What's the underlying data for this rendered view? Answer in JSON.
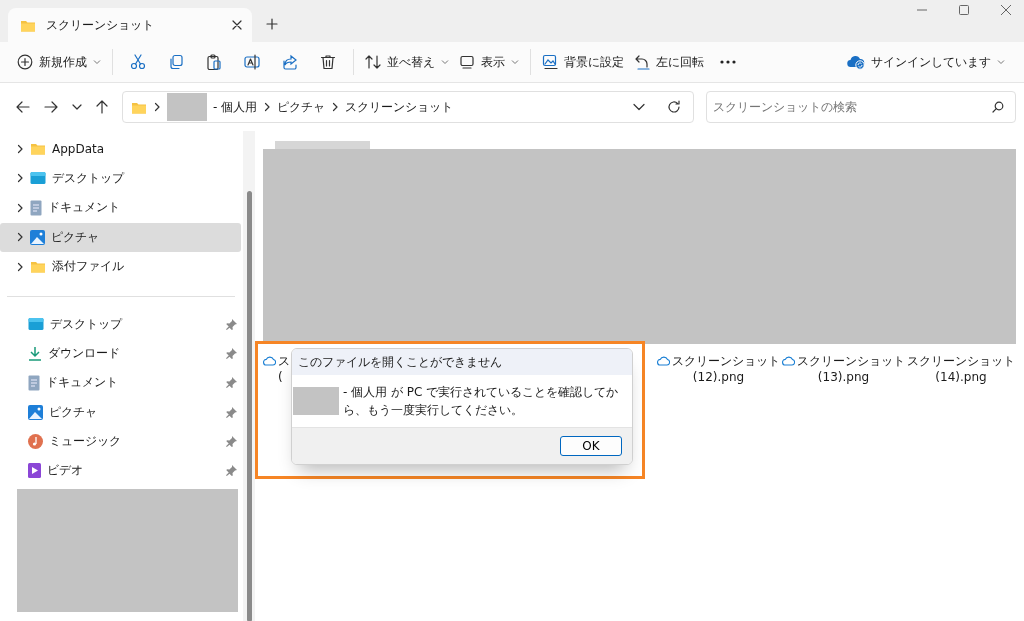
{
  "window": {
    "tab_title": "スクリーンショット"
  },
  "toolbar": {
    "new": "新規作成",
    "sort": "並べ替え",
    "view": "表示",
    "set_background": "背景に設定",
    "rotate_left": "左に回転",
    "account": "サインインしています"
  },
  "address_bar": {
    "segments": [
      {
        "label": "- 個人用",
        "redacted_prefix": true
      },
      {
        "label": "ピクチャ",
        "redacted_prefix": false
      },
      {
        "label": "スクリーンショット",
        "redacted_prefix": false
      }
    ]
  },
  "search": {
    "placeholder": "スクリーンショットの検索"
  },
  "nav_tree": [
    {
      "label": "AppData",
      "selected": false
    },
    {
      "label": "デスクトップ",
      "selected": false
    },
    {
      "label": "ドキュメント",
      "selected": false
    },
    {
      "label": "ピクチャ",
      "selected": true
    },
    {
      "label": "添付ファイル",
      "selected": false
    }
  ],
  "quick_access": [
    {
      "label": "デスクトップ",
      "pinned": true
    },
    {
      "label": "ダウンロード",
      "pinned": true
    },
    {
      "label": "ドキュメント",
      "pinned": true
    },
    {
      "label": "ピクチャ",
      "pinned": true
    },
    {
      "label": "ミュージック",
      "pinned": true
    },
    {
      "label": "ビデオ",
      "pinned": true
    }
  ],
  "files": [
    {
      "name": "ス",
      "name_line2": "(",
      "cloud": true
    },
    {
      "name": "スクリーンショット",
      "name_line2": "(12).png",
      "cloud": true
    },
    {
      "name": "スクリーンショット",
      "name_line2": "(13).png",
      "cloud": true
    },
    {
      "name": "スクリーンショット",
      "name_line2": "(14).png",
      "cloud": false
    }
  ],
  "dialog": {
    "title": "このファイルを開くことができません",
    "message": "- 個人用 が PC で実行されていることを確認してから、もう一度実行してください。",
    "message_redacted_prefix": true,
    "button": "OK"
  }
}
